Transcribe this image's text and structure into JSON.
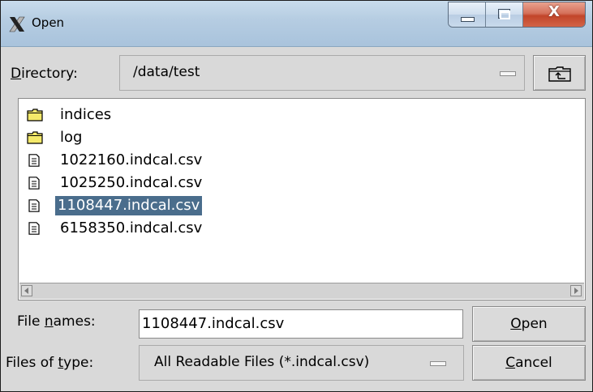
{
  "window": {
    "title": "Open",
    "app_icon": "x11-icon",
    "controls": {
      "minimize": "minimize-icon",
      "maximize": "maximize-icon",
      "close": "close-icon",
      "close_glyph": "X"
    }
  },
  "directory": {
    "label": "Directory:",
    "mnemonic": "D",
    "label_rest": "irectory:",
    "value": "/data/test",
    "up_icon": "folder-up-icon"
  },
  "files": [
    {
      "name": "indices",
      "type": "folder",
      "selected": false
    },
    {
      "name": "log",
      "type": "folder",
      "selected": false
    },
    {
      "name": "1022160.indcal.csv",
      "type": "file",
      "selected": false
    },
    {
      "name": "1025250.indcal.csv",
      "type": "file",
      "selected": false
    },
    {
      "name": "1108447.indcal.csv",
      "type": "file",
      "selected": true
    },
    {
      "name": "6158350.indcal.csv",
      "type": "file",
      "selected": false
    }
  ],
  "file_names": {
    "label_pre": "File ",
    "mnemonic": "n",
    "label_post": "ames:",
    "value": "1108447.indcal.csv"
  },
  "file_type": {
    "label_pre": "Files of ",
    "mnemonic": "t",
    "label_post": "ype:",
    "value": "All Readable Files (*.indcal.csv)"
  },
  "buttons": {
    "open_mnemonic": "O",
    "open_rest": "pen",
    "cancel_mnemonic": "C",
    "cancel_rest": "ancel"
  },
  "colors": {
    "selection": "#4a6d8c",
    "folder": "#f4e96a",
    "close_button": "#c2452a"
  }
}
